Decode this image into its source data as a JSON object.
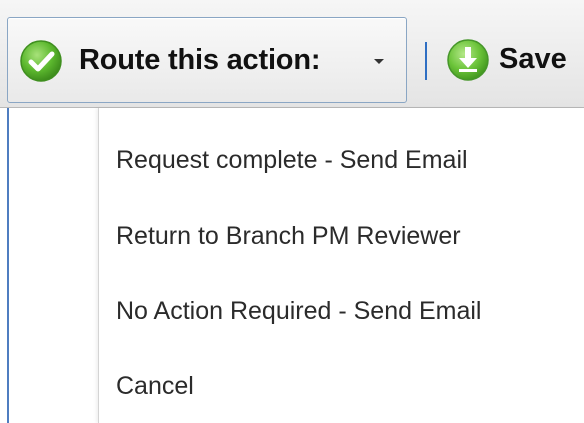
{
  "toolbar": {
    "route_label": "Route this action:",
    "save_label": "Save"
  },
  "colors": {
    "check_icon": "#5cb82e",
    "save_icon": "#6cc43a",
    "separator": "#2f6fc3",
    "border_accent": "#4f7dc0"
  },
  "icons": {
    "route": "check-circle-icon",
    "route_caret": "caret-down-icon",
    "save": "download-circle-icon"
  },
  "menu": {
    "items": [
      {
        "label": "Request complete - Send Email"
      },
      {
        "label": "Return to Branch PM Reviewer"
      },
      {
        "label": "No Action Required - Send Email"
      },
      {
        "label": "Cancel"
      }
    ]
  }
}
